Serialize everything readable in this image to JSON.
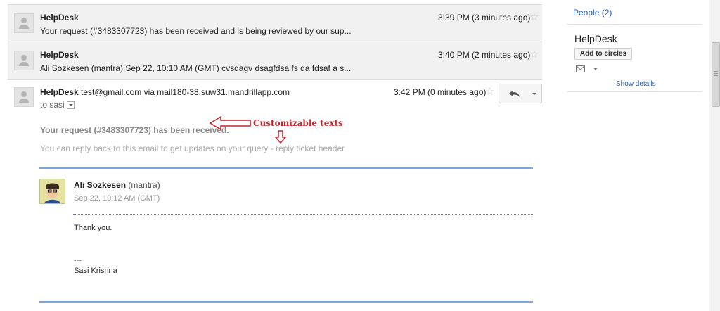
{
  "messages": [
    {
      "sender": "HelpDesk",
      "snippet": "Your request (#3483307723) has been received and is being reviewed by our sup...",
      "time": "3:39 PM (3 minutes ago)"
    },
    {
      "sender": "HelpDesk",
      "snippet": "Ali Sozkesen (mantra) Sep 22, 10:10 AM (GMT) cvsdagv dsagfdsa fs da fdsaf a s...",
      "time": "3:40 PM (2 minutes ago)"
    }
  ],
  "open_message": {
    "sender": "HelpDesk",
    "email": "test@gmail.com",
    "via_label": "via",
    "via_host": "mail180-38.suw31.mandrillapp.com",
    "to": "to sasi",
    "time": "3:42 PM (0 minutes ago)",
    "body_heading": "Your request (#3483307723) has been received.",
    "body_sub": "You can reply back to this email to get updates on your query - reply ticket header",
    "annotation": "Customizable texts",
    "quoted": {
      "author": "Ali Sozkesen",
      "author_suffix": "(mantra)",
      "date": "Sep 22, 10:12 AM (GMT)",
      "text": "Thank you.",
      "sig_dash": "---",
      "signature": "Sasi Krishna"
    }
  },
  "sidebar": {
    "people_link": "People (2)",
    "contact_name": "HelpDesk",
    "add_button": "Add to circles",
    "show_details": "Show details"
  },
  "colors": {
    "annotation": "#c1272d",
    "link": "#2a5db0",
    "divider": "#7aa6db"
  }
}
